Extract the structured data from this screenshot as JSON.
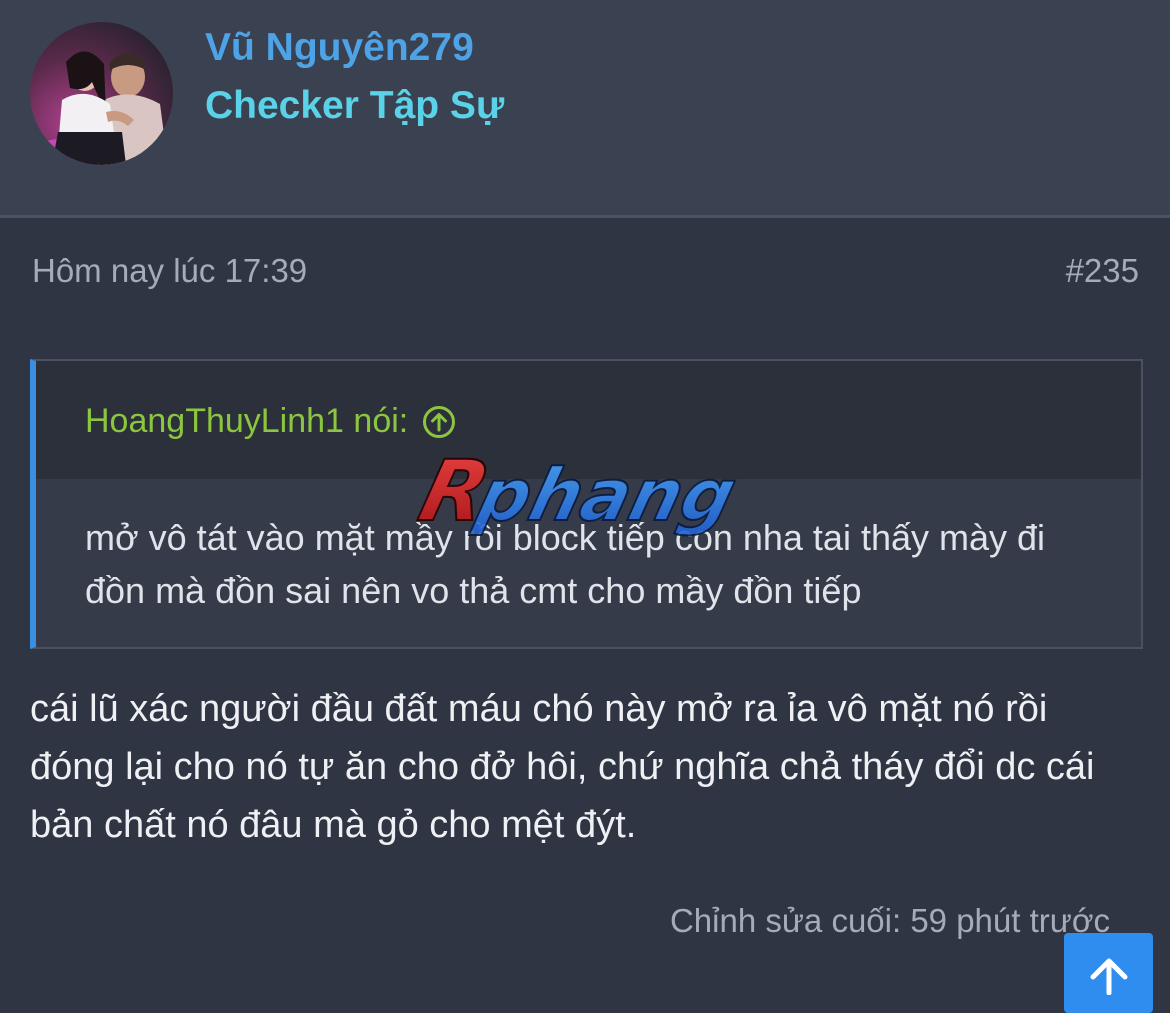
{
  "user": {
    "name": "Vũ Nguyên279",
    "title": "Checker Tập Sự",
    "avatar_icon": "avatar-photo"
  },
  "post": {
    "time": "Hôm nay lúc 17:39",
    "number": "#235",
    "quote": {
      "author": "HoangThuyLinh1 nói:",
      "author_icon": "arrow-up-circle-icon",
      "text": "mở vô tát vào mặt mầy rồi block tiếp con nha tai thấy mày đi đồn mà đồn sai nên vo thả cmt cho mầy đồn tiếp"
    },
    "message": "cái lũ xác người đầu đất máu chó này mở ra ỉa vô mặt nó rồi đóng lại cho nó tự ăn cho đở hôi, chứ nghĩa chả tháy đổi dc cái bản chất nó đâu mà gỏ cho mệt đýt.",
    "edit_note": "Chỉnh sửa cuối: 59 phút trước"
  },
  "watermark": "Rphang",
  "scroll_top_icon": "arrow-up-icon",
  "colors": {
    "background": "#2f3542",
    "header": "#3a4150",
    "username": "#4ea3e6",
    "usertitle": "#5ad2e8",
    "quote_author": "#8cc63f",
    "quote_accent": "#3a8fe0",
    "scroll_button": "#2f8df0"
  }
}
